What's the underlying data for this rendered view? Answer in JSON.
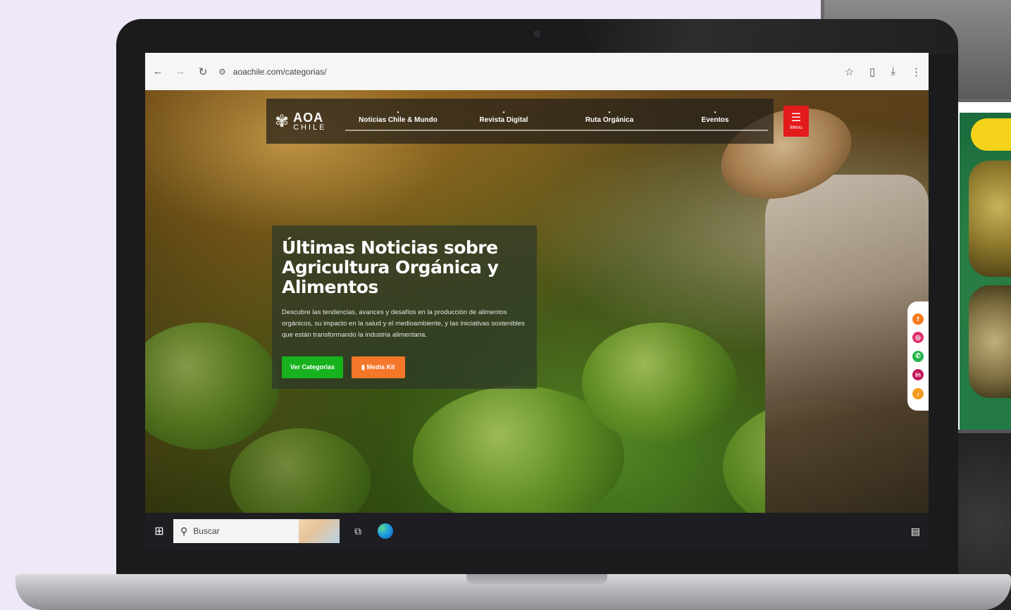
{
  "browser": {
    "back_icon": "arrow-left-icon",
    "forward_icon": "arrow-right-icon",
    "reload_icon": "reload-icon",
    "url": "aoachile.com/categorias/",
    "bookmark_icon": "star-icon",
    "extensions_icon": "puzzle-icon",
    "download_icon": "download-icon",
    "more_icon": "more-vertical-icon"
  },
  "site": {
    "logo": {
      "line1": "AOA",
      "line2": "CHILE"
    },
    "nav": [
      {
        "label": "Noticias Chile & Mundo"
      },
      {
        "label": "Revista Digital"
      },
      {
        "label": "Ruta Orgánica"
      },
      {
        "label": "Eventos"
      }
    ],
    "menu_label": "Menu",
    "menu_color": "#e41b1b"
  },
  "hero": {
    "title": "Últimas Noticias sobre Agricultura Orgánica y Alimentos",
    "description": "Descubre las tendencias, avances y desafíos en la producción de alimentos orgánicos, su impacto en la salud y el medioambiente, y las iniciativas sostenibles que están transformando la industria alimentaria.",
    "button_primary": "Ver Categorías",
    "button_secondary": "Media Kit",
    "primary_color": "#18b21f",
    "secondary_color": "#f4772a"
  },
  "social": [
    {
      "name": "facebook-icon",
      "color": "#f47b20"
    },
    {
      "name": "instagram-icon",
      "color": "#e1306c"
    },
    {
      "name": "whatsapp-icon",
      "color": "#25b34a"
    },
    {
      "name": "linkedin-icon",
      "color": "#c2185b"
    },
    {
      "name": "tiktok-icon",
      "color": "#f49b20"
    }
  ],
  "taskbar": {
    "search_placeholder": "Buscar"
  }
}
